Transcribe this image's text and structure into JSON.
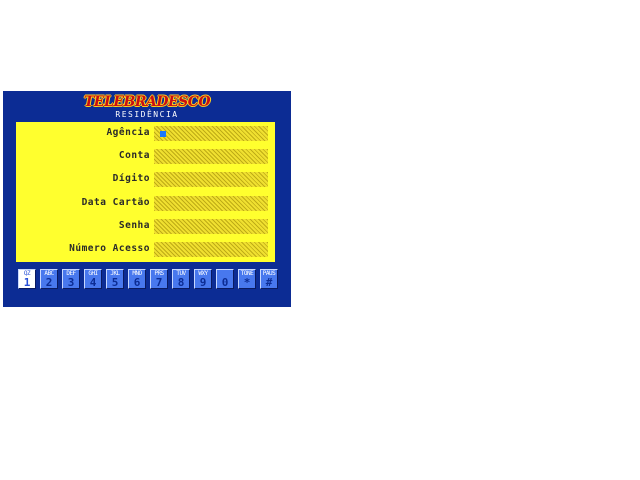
{
  "header": {
    "logo": "TELEBRADESCO",
    "subtitle": "RESIDÊNCIA"
  },
  "form": {
    "fields": [
      {
        "label": "Agência",
        "value": "",
        "focused": true
      },
      {
        "label": "Conta",
        "value": ""
      },
      {
        "label": "Dígito",
        "value": ""
      },
      {
        "label": "Data Cartão",
        "value": ""
      },
      {
        "label": "Senha",
        "value": ""
      },
      {
        "label": "Número Acesso",
        "value": ""
      }
    ]
  },
  "keypad": {
    "keys": [
      {
        "letters": "QZ",
        "digit": "1",
        "active": true
      },
      {
        "letters": "ABC",
        "digit": "2"
      },
      {
        "letters": "DEF",
        "digit": "3"
      },
      {
        "letters": "GHI",
        "digit": "4"
      },
      {
        "letters": "JKL",
        "digit": "5"
      },
      {
        "letters": "MNO",
        "digit": "6"
      },
      {
        "letters": "PRS",
        "digit": "7"
      },
      {
        "letters": "TUV",
        "digit": "8"
      },
      {
        "letters": "WXY",
        "digit": "9"
      },
      {
        "letters": "",
        "digit": "0"
      },
      {
        "letters": "TONE",
        "digit": "*"
      },
      {
        "letters": "PAUS",
        "digit": "#"
      }
    ]
  },
  "colors": {
    "panel": "#0c2c94",
    "form_background": "#ffff2e",
    "logo": "#c80e14",
    "key": "#4878ee",
    "cursor": "#1a78ff"
  }
}
